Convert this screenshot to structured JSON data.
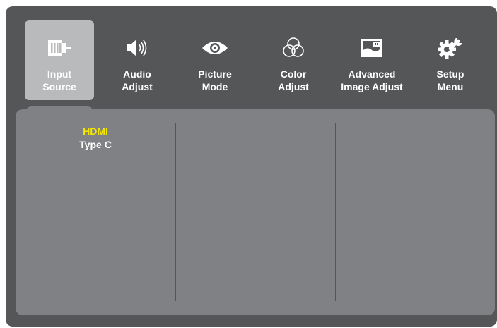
{
  "menu": {
    "tabs": [
      {
        "id": "input-source",
        "label": "Input\nSource",
        "icon": "input-source-icon",
        "active": true
      },
      {
        "id": "audio-adjust",
        "label": "Audio\nAdjust",
        "icon": "speaker-icon",
        "active": false
      },
      {
        "id": "picture-mode",
        "label": "Picture\nMode",
        "icon": "eye-icon",
        "active": false
      },
      {
        "id": "color-adjust",
        "label": "Color\nAdjust",
        "icon": "color-circles-icon",
        "active": false
      },
      {
        "id": "advanced-image-adjust",
        "label": "Advanced\nImage Adjust",
        "icon": "image-adjust-icon",
        "active": false
      },
      {
        "id": "setup-menu",
        "label": "Setup\nMenu",
        "icon": "gear-wrench-icon",
        "active": false
      }
    ]
  },
  "input_source": {
    "options": [
      {
        "label": "HDMI",
        "selected": true
      },
      {
        "label": "Type C",
        "selected": false
      }
    ]
  },
  "colors": {
    "panel_bg": "#555658",
    "content_bg": "#808184",
    "active_tab_bg": "#b9babc",
    "selected_text": "#f3e600",
    "text": "#ffffff"
  }
}
